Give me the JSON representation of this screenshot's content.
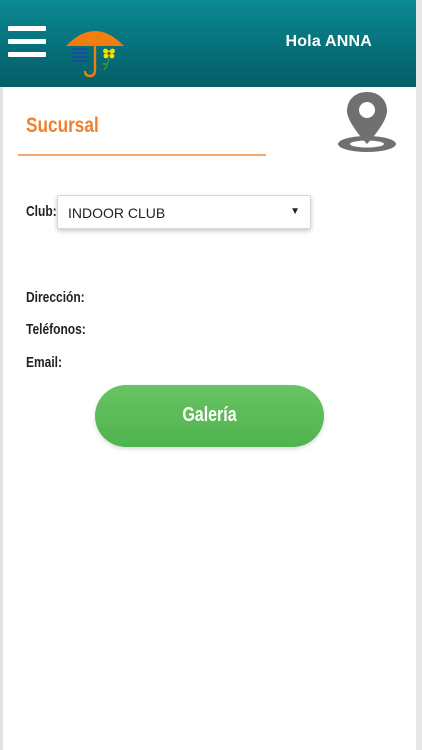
{
  "header": {
    "greeting": "Hola ANNA",
    "menu_icon": "hamburger-menu-icon",
    "logo_icon": "umbrella-logo-icon",
    "colors": {
      "bar": "#06707a",
      "logo_orange": "#f07f10"
    }
  },
  "section": {
    "title": "Sucursal",
    "title_color": "#f07f2e",
    "location_icon": "map-pin-icon"
  },
  "club": {
    "label": "Club:",
    "selected": "INDOOR CLUB",
    "dropdown_icon": "caret-down-icon"
  },
  "info": {
    "address_label": "Dirección:",
    "phones_label": "Teléfonos:",
    "email_label": "Email:"
  },
  "gallery_button": {
    "label": "Galería",
    "color": "#5bbb58"
  }
}
